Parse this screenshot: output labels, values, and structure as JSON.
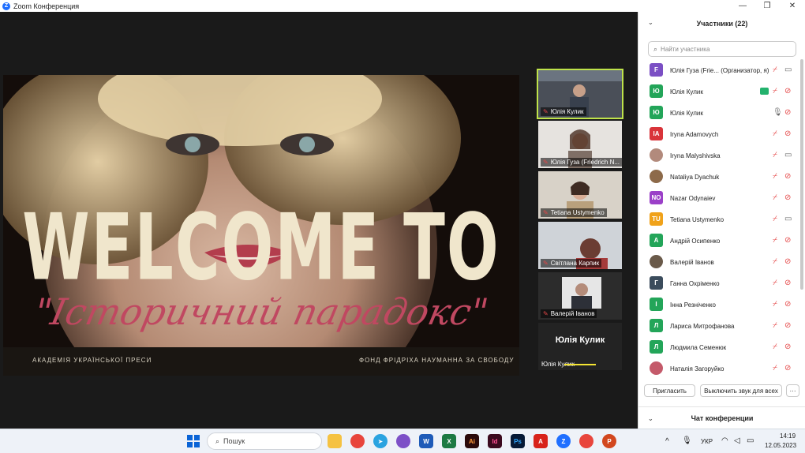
{
  "window": {
    "title": "Zoom Конференция",
    "controls": [
      "—",
      "❐",
      "✕"
    ]
  },
  "slide": {
    "headline": "WELCOME TO",
    "subtitle": "\"Історичний парадокс\"",
    "footer_left": "АКАДЕМІЯ УКРАЇНСЬКОЇ ПРЕСИ",
    "footer_right": "ФОНД ФРІДРІХА НАУМАННА ЗА СВОБОДУ"
  },
  "video_tiles": [
    {
      "name": "Юлія Кулик",
      "active": true
    },
    {
      "name": "Юлія Гуза (Friedrich N...",
      "active": false
    },
    {
      "name": "Tetiana Ustymenko",
      "active": false
    },
    {
      "name": "Світлана Карпик",
      "active": false
    },
    {
      "name": "Валерій Іванов",
      "active": false
    },
    {
      "name": "Юлія Кулик",
      "big": "Юлія Кулик",
      "active": false
    }
  ],
  "panel": {
    "title": "Участники (22)",
    "search_placeholder": "Найти участника",
    "participants": [
      {
        "initials": "F",
        "color": "#7b4fc4",
        "name": "Юлія Гуза (Frie... (Организатор, я)",
        "mic": "muted",
        "cam": "on"
      },
      {
        "initials": "Ю",
        "color": "#23a559",
        "name": "Юлія Кулик",
        "mic": "muted",
        "cam": "off",
        "sharing": true
      },
      {
        "initials": "Ю",
        "color": "#23a559",
        "name": "Юлія Кулик",
        "mic": "on",
        "cam": "off"
      },
      {
        "initials": "IA",
        "color": "#d9343a",
        "name": "Iryna Adamovych",
        "mic": "muted",
        "cam": "off"
      },
      {
        "initials": "",
        "color": "#b28a7c",
        "name": "Iryna Malyshivska",
        "mic": "muted",
        "cam": "on",
        "photo": true
      },
      {
        "initials": "",
        "color": "#8d6a4a",
        "name": "Nataliya Dyachuk",
        "mic": "muted",
        "cam": "off",
        "photo": true
      },
      {
        "initials": "NO",
        "color": "#9b40c8",
        "name": "Nazar Odynaiev",
        "mic": "muted",
        "cam": "off"
      },
      {
        "initials": "TU",
        "color": "#f0a21a",
        "name": "Tetiana Ustymenko",
        "mic": "muted",
        "cam": "on"
      },
      {
        "initials": "А",
        "color": "#23a559",
        "name": "Андрій Осипенко",
        "mic": "muted",
        "cam": "off"
      },
      {
        "initials": "",
        "color": "#6a5a4a",
        "name": "Валерій Іванов",
        "mic": "muted",
        "cam": "off",
        "photo": true
      },
      {
        "initials": "Г",
        "color": "#3b4c5c",
        "name": "Ганна Охріменко",
        "mic": "muted",
        "cam": "off"
      },
      {
        "initials": "І",
        "color": "#23a559",
        "name": "Інна Резніченко",
        "mic": "muted",
        "cam": "off"
      },
      {
        "initials": "Л",
        "color": "#23a559",
        "name": "Лариса Митрофанова",
        "mic": "muted",
        "cam": "off"
      },
      {
        "initials": "Л",
        "color": "#23a559",
        "name": "Людмила Семенюк",
        "mic": "muted",
        "cam": "off"
      },
      {
        "initials": "",
        "color": "#c45a6a",
        "name": "Наталія Загоруйко",
        "mic": "muted",
        "cam": "off",
        "photo": true
      }
    ],
    "invite_label": "Пригласить",
    "mute_all_label": "Выключить звук для всех",
    "more_label": "···",
    "chat_title": "Чат конференции"
  },
  "taskbar": {
    "search_placeholder": "Пошук",
    "lang": "УКР",
    "time": "14:19",
    "date": "12.05.2023"
  }
}
